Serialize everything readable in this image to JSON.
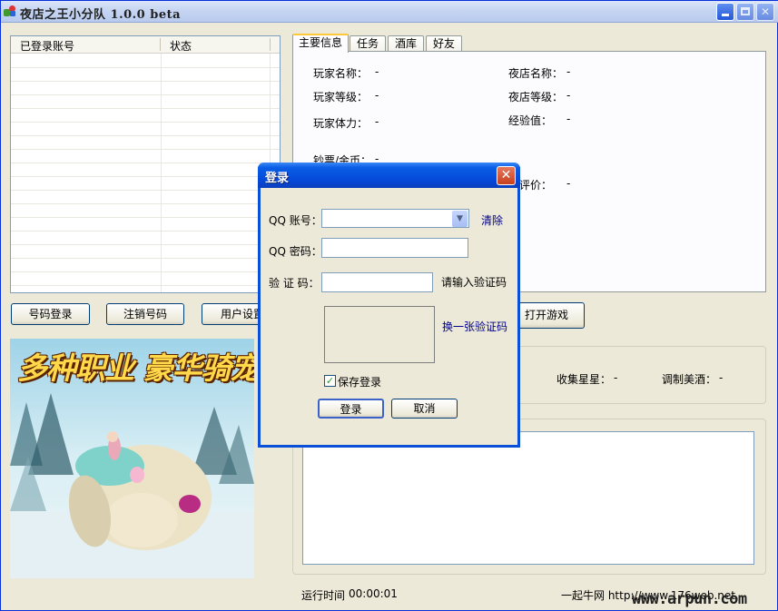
{
  "window": {
    "title": "夜店之王小分队 1.0.0 beta"
  },
  "accounts_list": {
    "columns": [
      "已登录账号",
      "状态"
    ],
    "rows": []
  },
  "buttons": {
    "login_account": "号码登录",
    "logout_account": "注销号码",
    "user_settings": "用户设置",
    "open_game": "打开游戏"
  },
  "banner": {
    "text": "多种职业 豪华骑宠"
  },
  "tabs": [
    "主要信息",
    "任务",
    "酒库",
    "好友"
  ],
  "main_info": {
    "player_name": {
      "label": "玩家名称：",
      "value": "-"
    },
    "player_level": {
      "label": "玩家等级：",
      "value": "-"
    },
    "player_stamina": {
      "label": "玩家体力：",
      "value": "-"
    },
    "club_name": {
      "label": "夜店名称：",
      "value": "-"
    },
    "club_level": {
      "label": "夜店等级：",
      "value": "-"
    },
    "experience": {
      "label": "经验值：",
      "value": "-"
    },
    "money": {
      "label": "钞票/金币：",
      "value": "-"
    },
    "daily_rating": {
      "label": "日评价：",
      "value": "-"
    }
  },
  "stats": {
    "collected_stars": {
      "label": "收集星星：",
      "value": "-"
    },
    "mixed_drinks": {
      "label": "调制美酒：",
      "value": "-"
    }
  },
  "status_bar": {
    "runtime_label": "运行时间",
    "runtime_value": "00:00:01",
    "site_label": "一起牛网 http://www.176web.net",
    "watermark": "www.arpun.com"
  },
  "login_dialog": {
    "title": "登录",
    "close_glyph": "✕",
    "qq_account_label": "QQ 账号：",
    "qq_account_value": "",
    "clear_link": "清除",
    "qq_password_label": "QQ 密码：",
    "captcha_label": "验 证 码：",
    "captcha_hint": "请输入验证码",
    "refresh_captcha_link": "换一张验证码",
    "save_login_label": "保存登录",
    "save_login_checked": true,
    "ok_button": "登录",
    "cancel_button": "取消"
  }
}
